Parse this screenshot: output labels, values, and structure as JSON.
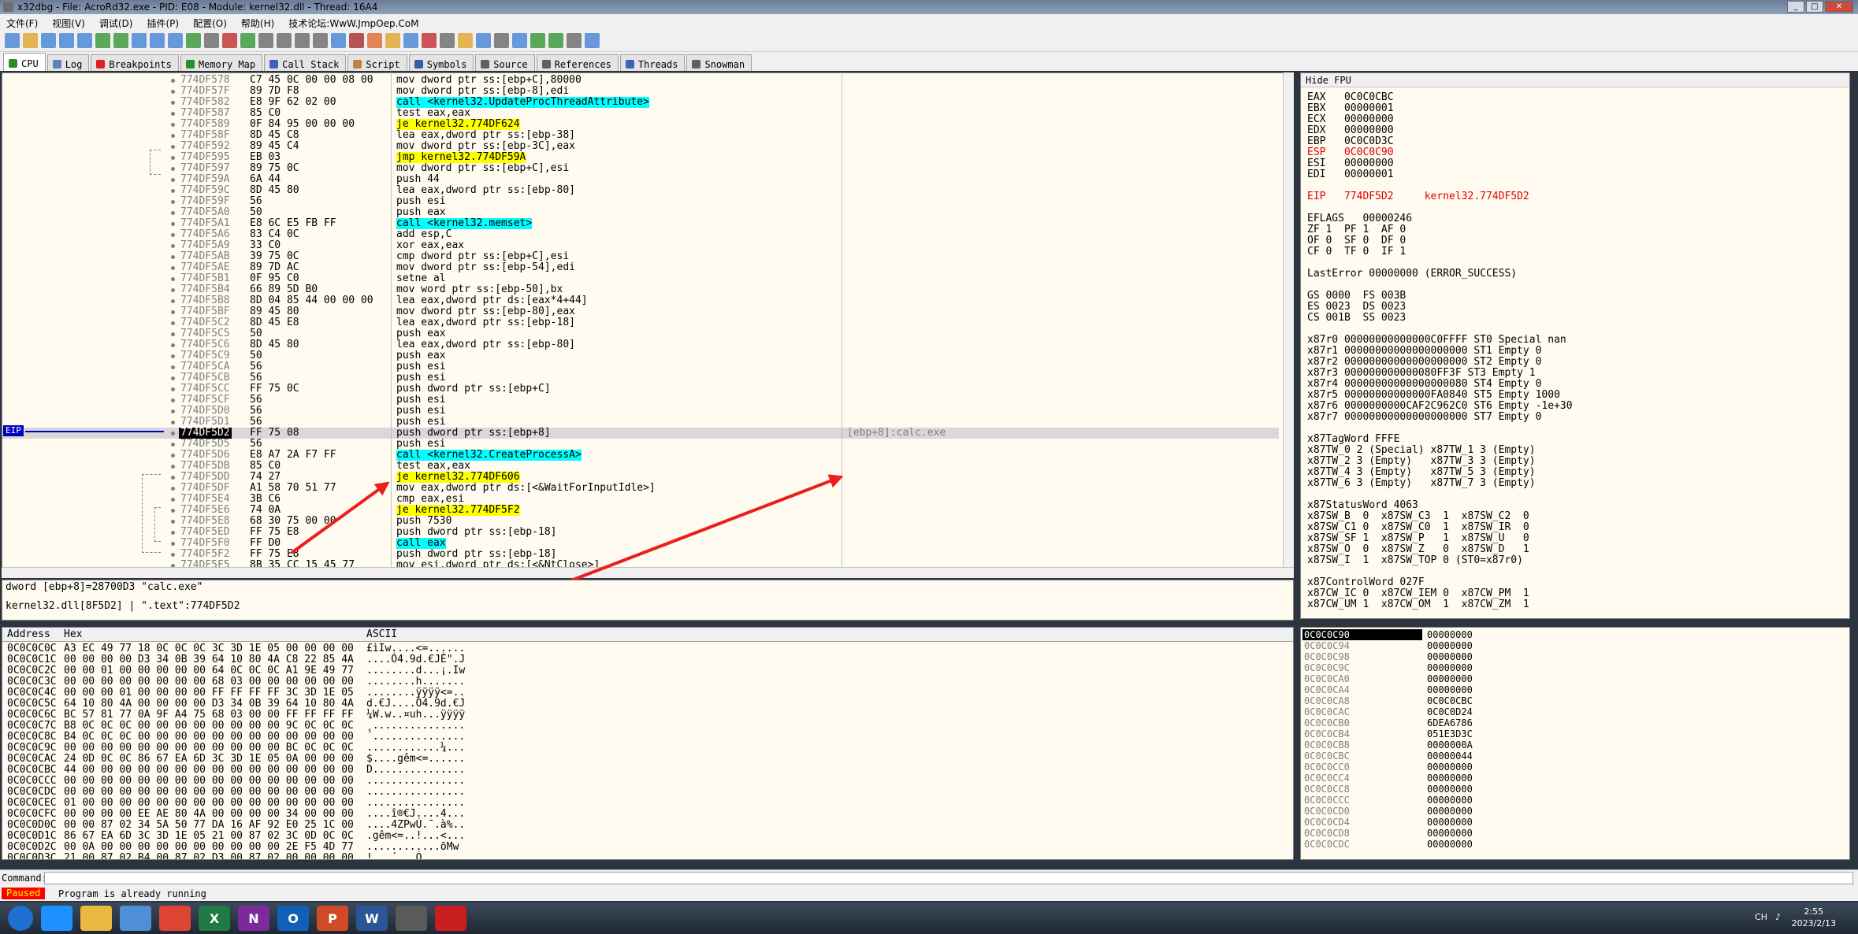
{
  "window": {
    "title": "x32dbg - File: AcroRd32.exe - PID: E08 - Module: kernel32.dll - Thread: 16A4"
  },
  "menu": [
    "文件(F)",
    "视图(V)",
    "调试(D)",
    "插件(P)",
    "配置(O)",
    "帮助(H)",
    "技术论坛:WwW.JmpOep.CoM"
  ],
  "tabs": [
    {
      "label": "CPU",
      "icon": "cpu-icon",
      "color": "#2a8f2a"
    },
    {
      "label": "Log",
      "icon": "log-icon",
      "color": "#6080c0"
    },
    {
      "label": "Breakpoints",
      "icon": "breakpoint-icon",
      "color": "#e02020"
    },
    {
      "label": "Memory Map",
      "icon": "memory-icon",
      "color": "#2a8f2a"
    },
    {
      "label": "Call Stack",
      "icon": "callstack-icon",
      "color": "#4060c0"
    },
    {
      "label": "Script",
      "icon": "script-icon",
      "color": "#c08040"
    },
    {
      "label": "Symbols",
      "icon": "symbols-icon",
      "color": "#3060a0"
    },
    {
      "label": "Source",
      "icon": "source-icon",
      "color": "#606060"
    },
    {
      "label": "References",
      "icon": "references-icon",
      "color": "#606060"
    },
    {
      "label": "Threads",
      "icon": "threads-icon",
      "color": "#4060c0"
    },
    {
      "label": "Snowman",
      "icon": "snowman-icon",
      "color": "#606060"
    }
  ],
  "disasm": {
    "eip_label": "EIP",
    "rows": [
      {
        "addr": "774DF578",
        "bytes": "C7 45 0C 00 00 08 00",
        "ins": "mov dword ptr ss:[ebp+C],80000"
      },
      {
        "addr": "774DF57F",
        "bytes": "89 7D F8",
        "ins": "mov dword ptr ss:[ebp-8],edi"
      },
      {
        "addr": "774DF582",
        "bytes": "E8 9F 62 02 00",
        "ins": "call <kernel32.UpdateProcThreadAttribute>",
        "hl": "call"
      },
      {
        "addr": "774DF587",
        "bytes": "85 C0",
        "ins": "test eax,eax"
      },
      {
        "addr": "774DF589",
        "bytes": "0F 84 95 00 00 00",
        "ins": "je kernel32.774DF624",
        "hl": "jmp"
      },
      {
        "addr": "774DF58F",
        "bytes": "8D 45 C8",
        "ins": "lea eax,dword ptr ss:[ebp-38]"
      },
      {
        "addr": "774DF592",
        "bytes": "89 45 C4",
        "ins": "mov dword ptr ss:[ebp-3C],eax"
      },
      {
        "addr": "774DF595",
        "bytes": "EB 03",
        "ins": "jmp kernel32.774DF59A",
        "hl": "jmp"
      },
      {
        "addr": "774DF597",
        "bytes": "89 75 0C",
        "ins": "mov dword ptr ss:[ebp+C],esi"
      },
      {
        "addr": "774DF59A",
        "bytes": "6A 44",
        "ins": "push 44"
      },
      {
        "addr": "774DF59C",
        "bytes": "8D 45 80",
        "ins": "lea eax,dword ptr ss:[ebp-80]"
      },
      {
        "addr": "774DF59F",
        "bytes": "56",
        "ins": "push esi"
      },
      {
        "addr": "774DF5A0",
        "bytes": "50",
        "ins": "push eax"
      },
      {
        "addr": "774DF5A1",
        "bytes": "E8 6C E5 FB FF",
        "ins": "call <kernel32.memset>",
        "hl": "call"
      },
      {
        "addr": "774DF5A6",
        "bytes": "83 C4 0C",
        "ins": "add esp,C"
      },
      {
        "addr": "774DF5A9",
        "bytes": "33 C0",
        "ins": "xor eax,eax"
      },
      {
        "addr": "774DF5AB",
        "bytes": "39 75 0C",
        "ins": "cmp dword ptr ss:[ebp+C],esi"
      },
      {
        "addr": "774DF5AE",
        "bytes": "89 7D AC",
        "ins": "mov dword ptr ss:[ebp-54],edi"
      },
      {
        "addr": "774DF5B1",
        "bytes": "0F 95 C0",
        "ins": "setne al"
      },
      {
        "addr": "774DF5B4",
        "bytes": "66 89 5D B0",
        "ins": "mov word ptr ss:[ebp-50],bx"
      },
      {
        "addr": "774DF5B8",
        "bytes": "8D 04 85 44 00 00 00",
        "ins": "lea eax,dword ptr ds:[eax*4+44]"
      },
      {
        "addr": "774DF5BF",
        "bytes": "89 45 80",
        "ins": "mov dword ptr ss:[ebp-80],eax"
      },
      {
        "addr": "774DF5C2",
        "bytes": "8D 45 E8",
        "ins": "lea eax,dword ptr ss:[ebp-18]"
      },
      {
        "addr": "774DF5C5",
        "bytes": "50",
        "ins": "push eax"
      },
      {
        "addr": "774DF5C6",
        "bytes": "8D 45 80",
        "ins": "lea eax,dword ptr ss:[ebp-80]"
      },
      {
        "addr": "774DF5C9",
        "bytes": "50",
        "ins": "push eax"
      },
      {
        "addr": "774DF5CA",
        "bytes": "56",
        "ins": "push esi"
      },
      {
        "addr": "774DF5CB",
        "bytes": "56",
        "ins": "push esi"
      },
      {
        "addr": "774DF5CC",
        "bytes": "FF 75 0C",
        "ins": "push dword ptr ss:[ebp+C]"
      },
      {
        "addr": "774DF5CF",
        "bytes": "56",
        "ins": "push esi"
      },
      {
        "addr": "774DF5D0",
        "bytes": "56",
        "ins": "push esi"
      },
      {
        "addr": "774DF5D1",
        "bytes": "56",
        "ins": "push esi"
      },
      {
        "addr": "774DF5D2",
        "bytes": "FF 75 08",
        "ins": "push dword ptr ss:[ebp+8]",
        "cmt": "[ebp+8]:calc.exe",
        "eip": true
      },
      {
        "addr": "774DF5D5",
        "bytes": "56",
        "ins": "push esi"
      },
      {
        "addr": "774DF5D6",
        "bytes": "E8 A7 2A F7 FF",
        "ins": "call <kernel32.CreateProcessA>",
        "hl": "call"
      },
      {
        "addr": "774DF5DB",
        "bytes": "85 C0",
        "ins": "test eax,eax"
      },
      {
        "addr": "774DF5DD",
        "bytes": "74 27",
        "ins": "je kernel32.774DF606",
        "hl": "jmp"
      },
      {
        "addr": "774DF5DF",
        "bytes": "A1 58 70 51 77",
        "ins": "mov eax,dword ptr ds:[<&WaitForInputIdle>]"
      },
      {
        "addr": "774DF5E4",
        "bytes": "3B C6",
        "ins": "cmp eax,esi"
      },
      {
        "addr": "774DF5E6",
        "bytes": "74 0A",
        "ins": "je kernel32.774DF5F2",
        "hl": "jmp"
      },
      {
        "addr": "774DF5E8",
        "bytes": "68 30 75 00 00",
        "ins": "push 7530"
      },
      {
        "addr": "774DF5ED",
        "bytes": "FF 75 E8",
        "ins": "push dword ptr ss:[ebp-18]"
      },
      {
        "addr": "774DF5F0",
        "bytes": "FF D0",
        "ins": "call eax",
        "hl": "call"
      },
      {
        "addr": "774DF5F2",
        "bytes": "FF 75 E8",
        "ins": "push dword ptr ss:[ebp-18]"
      },
      {
        "addr": "774DF5F5",
        "bytes": "8B 35 CC 15 45 77",
        "ins": "mov esi,dword ptr ds:[<&NtClose>]"
      }
    ]
  },
  "info": {
    "line1": "dword [ebp+8]=28700D3 \"calc.exe\"",
    "line2": "kernel32.dll[8F5D2] | \".text\":774DF5D2"
  },
  "registers": {
    "header": "Hide FPU",
    "lines": [
      {
        "t": "EAX   0C0C0CBC"
      },
      {
        "t": "EBX   00000001"
      },
      {
        "t": "ECX   00000000"
      },
      {
        "t": "EDX   00000000"
      },
      {
        "t": "EBP   0C0C0D3C"
      },
      {
        "t": "ESP   0C0C0C90",
        "red": true
      },
      {
        "t": "ESI   00000000"
      },
      {
        "t": "EDI   00000001"
      },
      {
        "t": ""
      },
      {
        "t": "EIP   774DF5D2     kernel32.774DF5D2",
        "red": true
      },
      {
        "t": ""
      },
      {
        "t": "EFLAGS   00000246"
      },
      {
        "t": "ZF 1  PF 1  AF 0"
      },
      {
        "t": "OF 0  SF 0  DF 0"
      },
      {
        "t": "CF 0  TF 0  IF 1"
      },
      {
        "t": ""
      },
      {
        "t": "LastError 00000000 (ERROR_SUCCESS)"
      },
      {
        "t": ""
      },
      {
        "t": "GS 0000  FS 003B"
      },
      {
        "t": "ES 0023  DS 0023"
      },
      {
        "t": "CS 001B  SS 0023"
      },
      {
        "t": ""
      },
      {
        "t": "x87r0 00000000000000C0FFFF ST0 Special nan"
      },
      {
        "t": "x87r1 00000000000000000000 ST1 Empty 0"
      },
      {
        "t": "x87r2 00000000000000000000 ST2 Empty 0"
      },
      {
        "t": "x87r3 000000000000080FF3F ST3 Empty 1"
      },
      {
        "t": "x87r4 00000000000000000080 ST4 Empty 0"
      },
      {
        "t": "x87r5 00000000000000FA0840 ST5 Empty 1000"
      },
      {
        "t": "x87r6 0000000000CAF2C962C0 ST6 Empty -1e+30"
      },
      {
        "t": "x87r7 00000000000000000000 ST7 Empty 0"
      },
      {
        "t": ""
      },
      {
        "t": "x87TagWord FFFE"
      },
      {
        "t": "x87TW_0 2 (Special) x87TW_1 3 (Empty)"
      },
      {
        "t": "x87TW_2 3 (Empty)   x87TW_3 3 (Empty)"
      },
      {
        "t": "x87TW_4 3 (Empty)   x87TW_5 3 (Empty)"
      },
      {
        "t": "x87TW_6 3 (Empty)   x87TW_7 3 (Empty)"
      },
      {
        "t": ""
      },
      {
        "t": "x87StatusWord 4063"
      },
      {
        "t": "x87SW_B  0  x87SW_C3  1  x87SW_C2  0"
      },
      {
        "t": "x87SW_C1 0  x87SW_C0  1  x87SW_IR  0"
      },
      {
        "t": "x87SW_SF 1  x87SW_P   1  x87SW_U   0"
      },
      {
        "t": "x87SW_O  0  x87SW_Z   0  x87SW_D   1"
      },
      {
        "t": "x87SW_I  1  x87SW_TOP 0 (ST0=x87r0)"
      },
      {
        "t": ""
      },
      {
        "t": "x87ControlWord 027F"
      },
      {
        "t": "x87CW_IC 0  x87CW_IEM 0  x87CW_PM  1"
      },
      {
        "t": "x87CW_UM 1  x87CW_OM  1  x87CW_ZM  1"
      }
    ]
  },
  "dump": {
    "headers": {
      "address": "Address",
      "hex": "Hex",
      "ascii": "ASCII"
    },
    "rows": [
      {
        "a": "0C0C0C0C",
        "h": "A3 EC 49 77 18 0C 0C 0C 3C 3D 1E 05 00 00 00 00",
        "s": "£ìIw....<=......"
      },
      {
        "a": "0C0C0C1C",
        "h": "00 00 00 00 D3 34 0B 39 64 10 80 4A C8 22 85 4A",
        "s": "....Ó4.9d.€JÈ\".J"
      },
      {
        "a": "0C0C0C2C",
        "h": "00 00 01 00 00 00 00 00 64 0C 0C 0C A1 9E 49 77",
        "s": "........d...¡.Iw"
      },
      {
        "a": "0C0C0C3C",
        "h": "00 00 00 00 00 00 00 00 68 03 00 00 00 00 00 00",
        "s": "........h......."
      },
      {
        "a": "0C0C0C4C",
        "h": "00 00 00 01 00 00 00 00 FF FF FF FF 3C 3D 1E 05",
        "s": "........ÿÿÿÿ<=.."
      },
      {
        "a": "0C0C0C5C",
        "h": "64 10 80 4A 00 00 00 00 D3 34 0B 39 64 10 80 4A",
        "s": "d.€J....Ó4.9d.€J"
      },
      {
        "a": "0C0C0C6C",
        "h": "BC 57 81 77 0A 9F A4 75 68 03 00 00 FF FF FF FF",
        "s": "¼W.w..¤uh...ÿÿÿÿ"
      },
      {
        "a": "0C0C0C7C",
        "h": "B8 0C 0C 0C 00 00 00 00 00 00 00 00 9C 0C 0C 0C",
        "s": "¸..............."
      },
      {
        "a": "0C0C0C8C",
        "h": "B4 0C 0C 0C 00 00 00 00 00 00 00 00 00 00 00 00",
        "s": "´..............."
      },
      {
        "a": "0C0C0C9C",
        "h": "00 00 00 00 00 00 00 00 00 00 00 00 BC 0C 0C 0C",
        "s": "............¼..."
      },
      {
        "a": "0C0C0CAC",
        "h": "24 0D 0C 0C 86 67 EA 6D 3C 3D 1E 05 0A 00 00 00",
        "s": "$....gêm<=......"
      },
      {
        "a": "0C0C0CBC",
        "h": "44 00 00 00 00 00 00 00 00 00 00 00 00 00 00 00",
        "s": "D..............."
      },
      {
        "a": "0C0C0CCC",
        "h": "00 00 00 00 00 00 00 00 00 00 00 00 00 00 00 00",
        "s": "................"
      },
      {
        "a": "0C0C0CDC",
        "h": "00 00 00 00 00 00 00 00 00 00 00 00 00 00 00 00",
        "s": "................"
      },
      {
        "a": "0C0C0CEC",
        "h": "01 00 00 00 00 00 00 00 00 00 00 00 00 00 00 00",
        "s": "................"
      },
      {
        "a": "0C0C0CFC",
        "h": "00 00 00 00 EE AE 80 4A 00 00 00 00 34 00 00 00",
        "s": "....î®€J....4..."
      },
      {
        "a": "0C0C0D0C",
        "h": "00 00 87 02 34 5A 50 77 DA 16 AF 92 E0 25 1C 00",
        "s": "....4ZPwÚ.¯.à%.."
      },
      {
        "a": "0C0C0D1C",
        "h": "86 67 EA 6D 3C 3D 1E 05 21 00 87 02 3C 0D 0C 0C",
        "s": ".gêm<=..!...<..."
      },
      {
        "a": "0C0C0D2C",
        "h": "00 0A 00 00 00 00 00 00 00 00 00 00 2E F5 4D 77",
        "s": "............õMw"
      },
      {
        "a": "0C0C0D3C",
        "h": "21 00 87 02 B4 00 87 02 D3 00 87 02 00 00 00 00",
        "s": "!...´...Ó......."
      }
    ]
  },
  "stack": {
    "rows": [
      {
        "a": "0C0C0C90",
        "v": "00000000",
        "top": true
      },
      {
        "a": "0C0C0C94",
        "v": "00000000"
      },
      {
        "a": "0C0C0C98",
        "v": "00000000"
      },
      {
        "a": "0C0C0C9C",
        "v": "00000000"
      },
      {
        "a": "0C0C0CA0",
        "v": "00000000"
      },
      {
        "a": "0C0C0CA4",
        "v": "00000000"
      },
      {
        "a": "0C0C0CA8",
        "v": "0C0C0CBC"
      },
      {
        "a": "0C0C0CAC",
        "v": "0C0C0D24"
      },
      {
        "a": "0C0C0CB0",
        "v": "6DEA6786"
      },
      {
        "a": "0C0C0CB4",
        "v": "051E3D3C"
      },
      {
        "a": "0C0C0CB8",
        "v": "0000000A"
      },
      {
        "a": "0C0C0CBC",
        "v": "00000044"
      },
      {
        "a": "0C0C0CC0",
        "v": "00000000"
      },
      {
        "a": "0C0C0CC4",
        "v": "00000000"
      },
      {
        "a": "0C0C0CC8",
        "v": "00000000"
      },
      {
        "a": "0C0C0CCC",
        "v": "00000000"
      },
      {
        "a": "0C0C0CD0",
        "v": "00000000"
      },
      {
        "a": "0C0C0CD4",
        "v": "00000000"
      },
      {
        "a": "0C0C0CD8",
        "v": "00000000"
      },
      {
        "a": "0C0C0CDC",
        "v": "00000000"
      }
    ]
  },
  "command": {
    "label": "Command:",
    "value": ""
  },
  "status": {
    "state": "Paused",
    "message": "Program is already running"
  },
  "taskbar": {
    "apps": [
      "start",
      "ie",
      "explorer",
      "media",
      "chrome",
      "excel",
      "onenote",
      "outlook",
      "powerpoint",
      "word",
      "x32dbg",
      "acrobat"
    ],
    "app_letters": {
      "excel": "X",
      "onenote": "N",
      "outlook": "O",
      "powerpoint": "P",
      "word": "W"
    },
    "lang": "CH",
    "time": "2:55",
    "date": "2023/2/13"
  }
}
